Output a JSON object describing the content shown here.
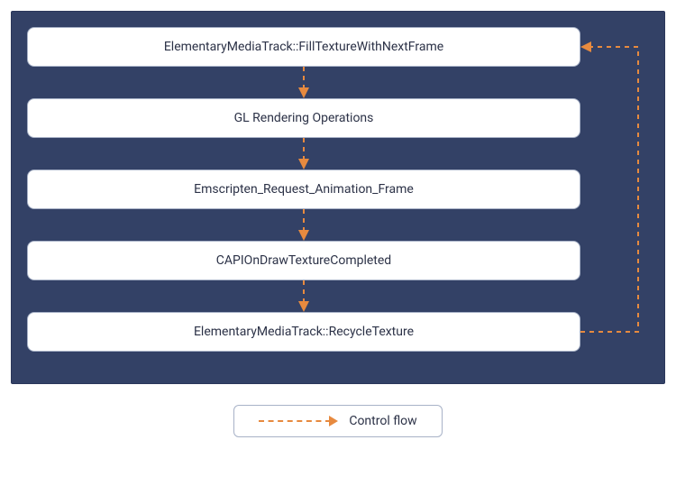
{
  "panel": {
    "bg": "#334166"
  },
  "nodes": {
    "n1": "ElementaryMediaTrack::FillTextureWithNextFrame",
    "n2": "GL Rendering Operations",
    "n3": "Emscripten_Request_Animation_Frame",
    "n4": "CAPIOnDrawTextureCompleted",
    "n5": "ElementaryMediaTrack::RecycleTexture"
  },
  "legend": {
    "label": "Control flow"
  },
  "chart_data": {
    "type": "flow",
    "title": "",
    "nodes": [
      {
        "id": "n1",
        "label": "ElementaryMediaTrack::FillTextureWithNextFrame"
      },
      {
        "id": "n2",
        "label": "GL Rendering Operations"
      },
      {
        "id": "n3",
        "label": "Emscripten_Request_Animation_Frame"
      },
      {
        "id": "n4",
        "label": "CAPIOnDrawTextureCompleted"
      },
      {
        "id": "n5",
        "label": "ElementaryMediaTrack::RecycleTexture"
      }
    ],
    "edges": [
      {
        "from": "n1",
        "to": "n2",
        "type": "control-flow"
      },
      {
        "from": "n2",
        "to": "n3",
        "type": "control-flow"
      },
      {
        "from": "n3",
        "to": "n4",
        "type": "control-flow"
      },
      {
        "from": "n4",
        "to": "n5",
        "type": "control-flow"
      },
      {
        "from": "n5",
        "to": "n1",
        "type": "control-flow",
        "note": "loop-back"
      }
    ],
    "legend": [
      {
        "style": "dashed-arrow",
        "color": "#e78a3f",
        "label": "Control flow"
      }
    ]
  }
}
